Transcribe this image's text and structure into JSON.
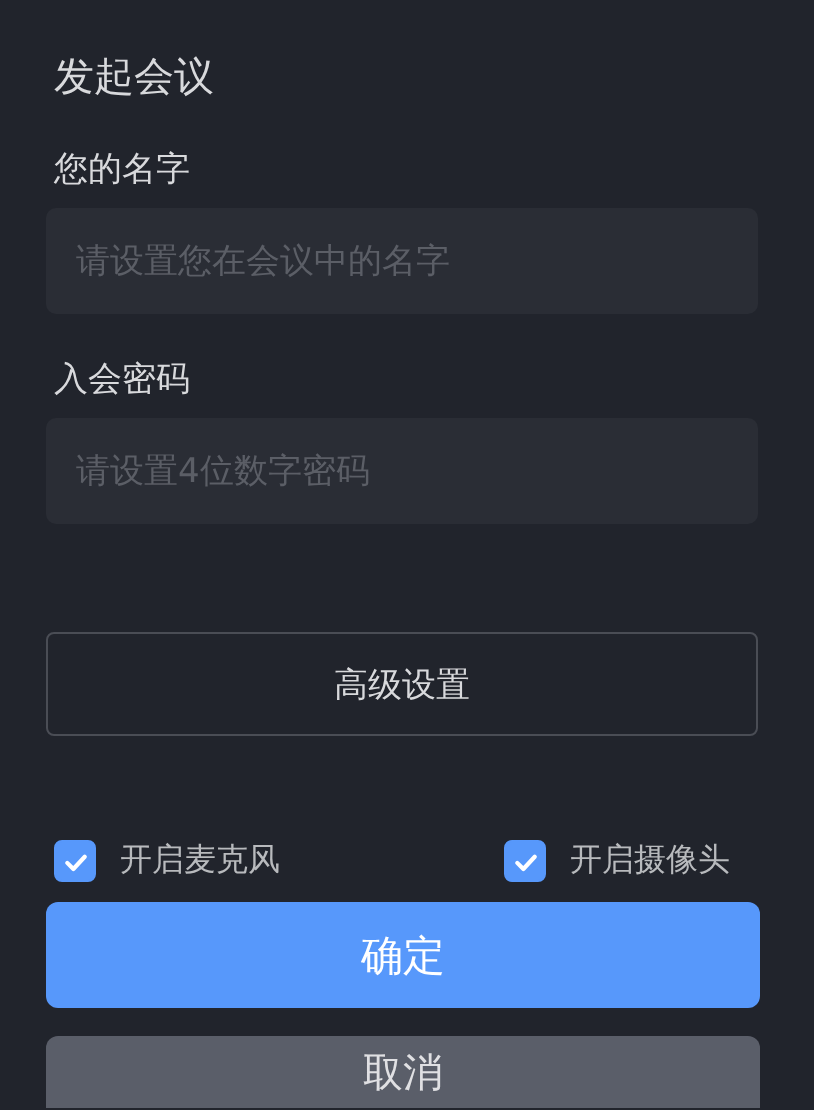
{
  "title": "发起会议",
  "fields": [
    {
      "label": "您的名字",
      "placeholder": "请设置您在会议中的名字"
    },
    {
      "label": "入会密码",
      "placeholder": "请设置4位数字密码"
    }
  ],
  "advanced_button": "高级设置",
  "options": [
    {
      "label": "开启麦克风",
      "checked": true
    },
    {
      "label": "开启摄像头",
      "checked": true
    }
  ],
  "confirm_button": "确定",
  "cancel_button": "取消"
}
